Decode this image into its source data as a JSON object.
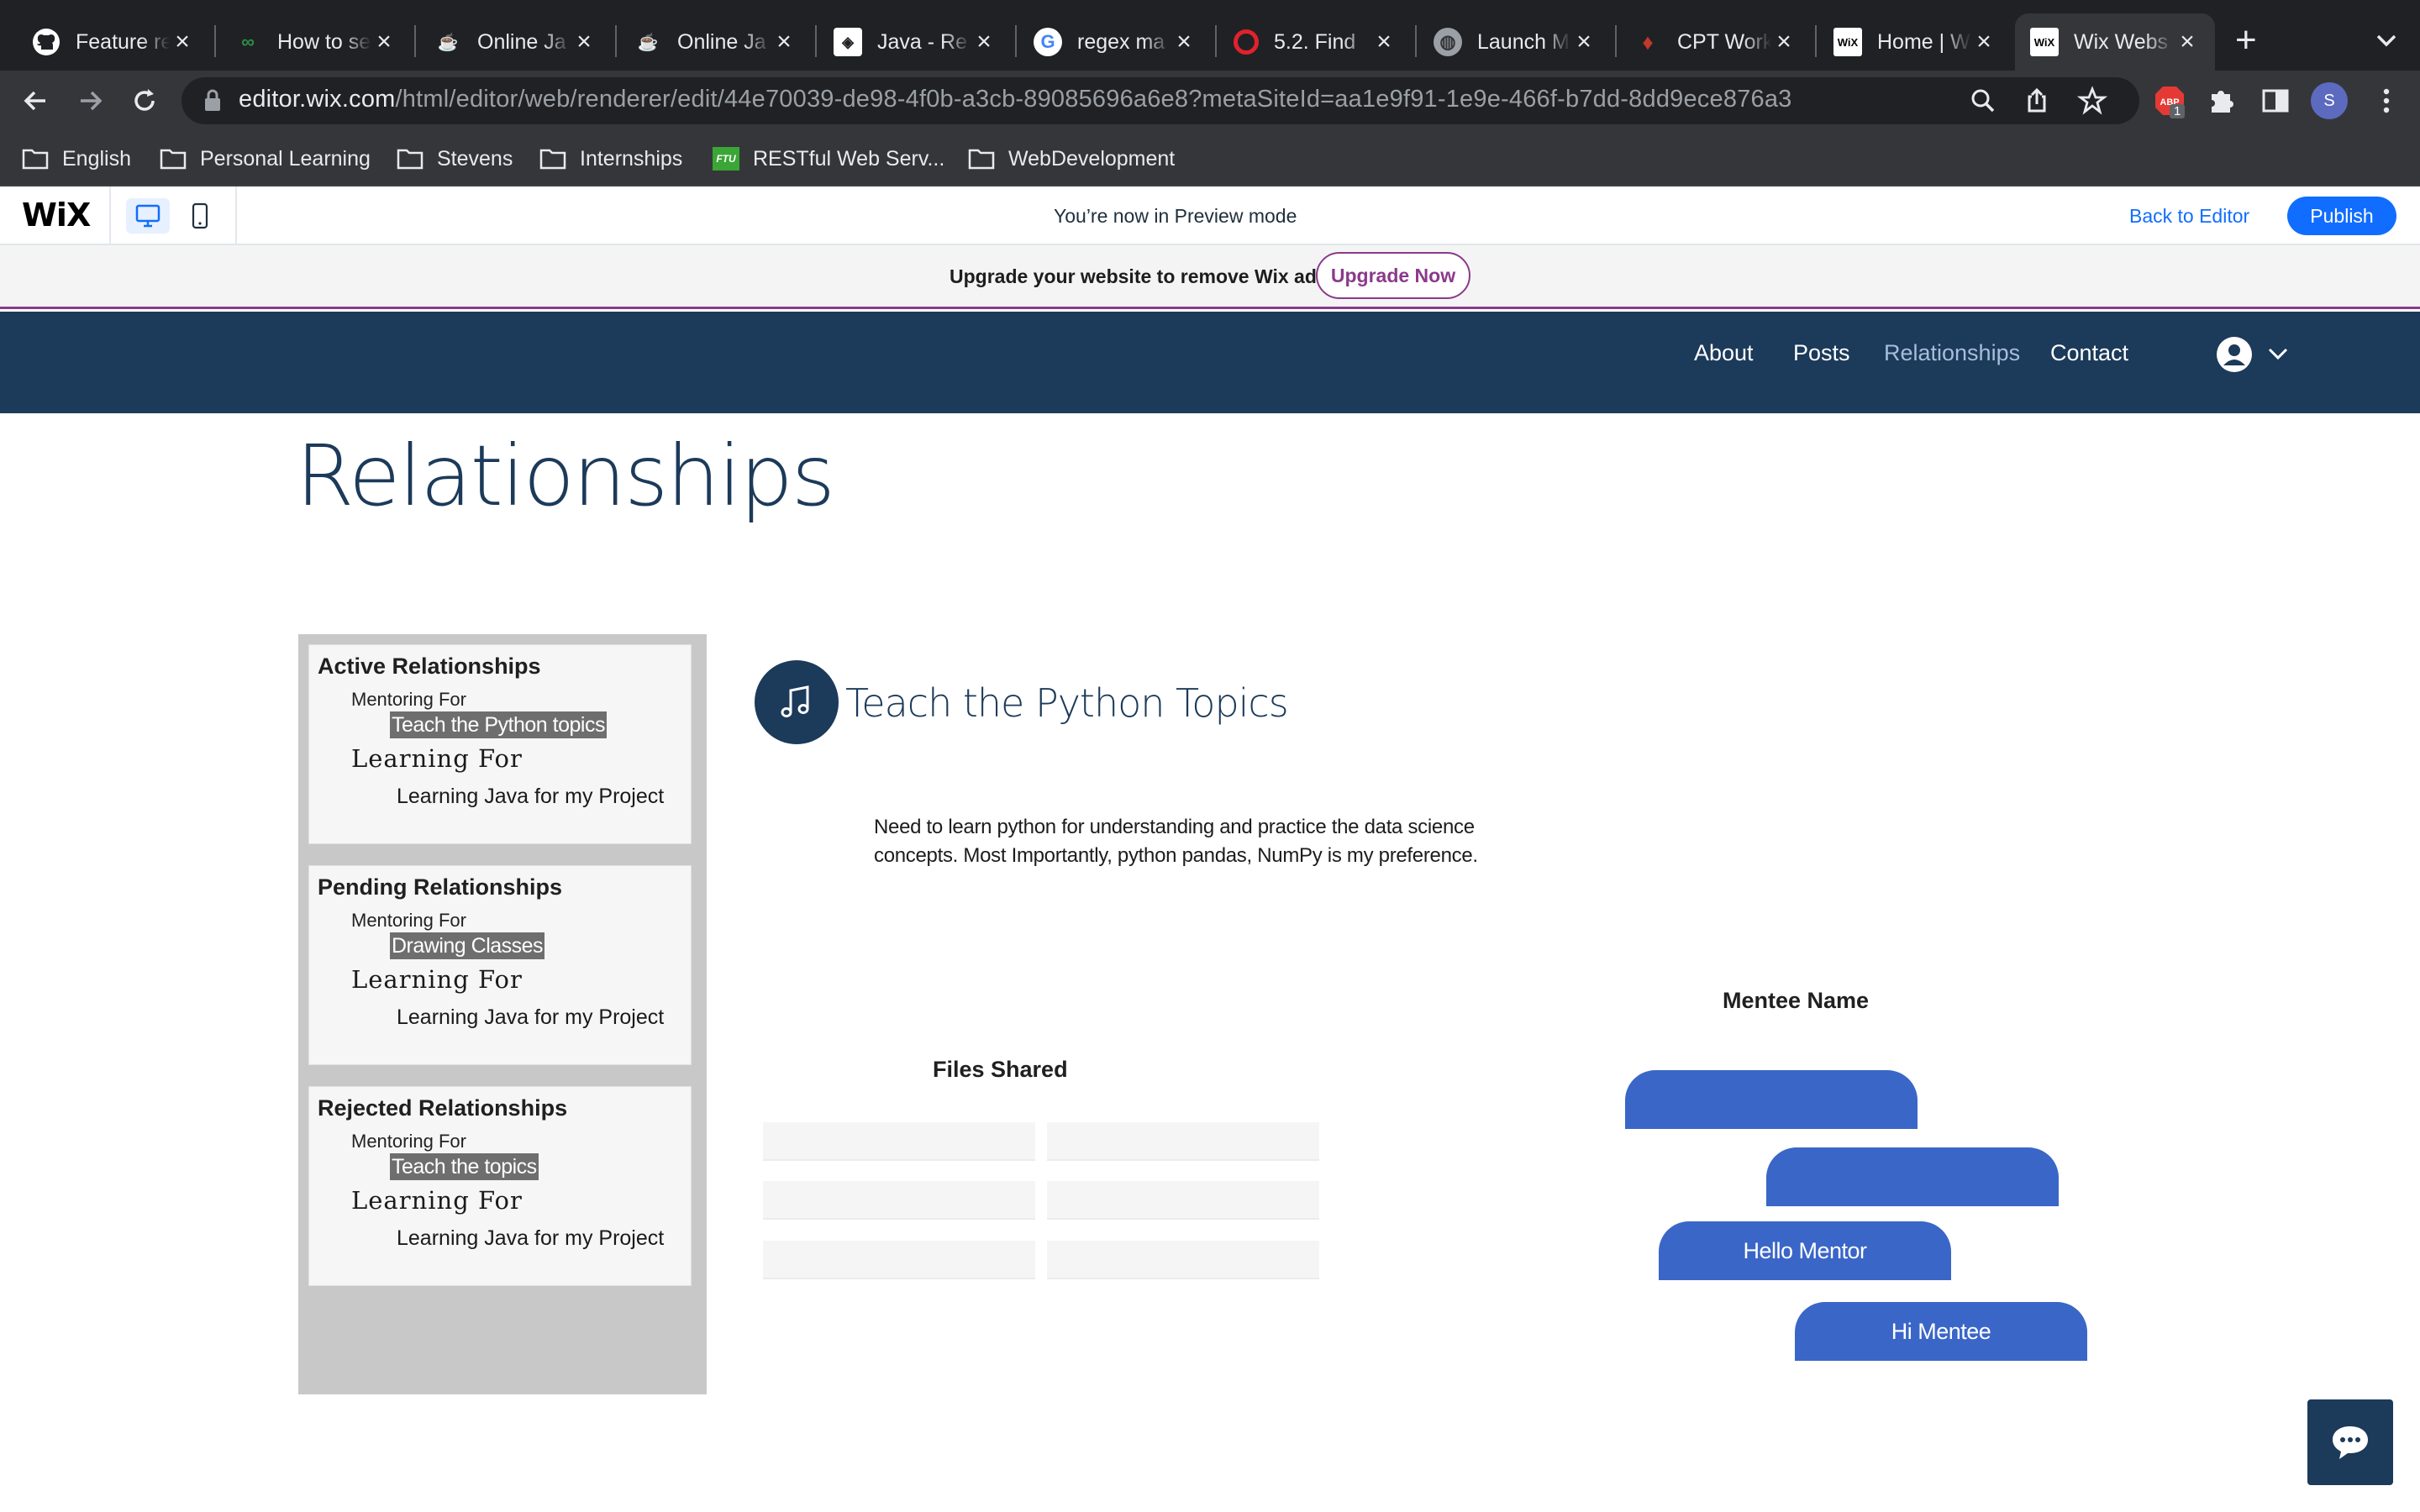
{
  "browser": {
    "tabs": [
      {
        "title": "Feature re",
        "favicon": "github-icon"
      },
      {
        "title": "How to se",
        "favicon": "geeksforgeeks-icon"
      },
      {
        "title": "Online Ja",
        "favicon": "online-java-icon"
      },
      {
        "title": "Online Ja",
        "favicon": "online-java-icon"
      },
      {
        "title": "Java - Re",
        "favicon": "java-ref-icon"
      },
      {
        "title": "regex ma",
        "favicon": "google-icon"
      },
      {
        "title": "5.2. Find",
        "favicon": "opera-icon"
      },
      {
        "title": "Launch M",
        "favicon": "globe-icon"
      },
      {
        "title": "CPT Work",
        "favicon": "cpt-icon"
      },
      {
        "title": "Home | W",
        "favicon": "wix-icon"
      },
      {
        "title": "Wix Webs",
        "favicon": "wix-icon"
      }
    ],
    "url_host": "editor.wix.com",
    "url_path": "/html/editor/web/renderer/edit/44e70039-de98-4f0b-a3cb-89085696a6e8?metaSiteId=aa1e9f91-1e9e-466f-b7dd-8dd9ece876a3",
    "extension_badge": "1",
    "profile_initial": "S",
    "bookmarks": [
      {
        "label": "English",
        "icon": "folder-icon"
      },
      {
        "label": "Personal Learning",
        "icon": "folder-icon"
      },
      {
        "label": "Stevens",
        "icon": "folder-icon"
      },
      {
        "label": "Internships",
        "icon": "folder-icon"
      },
      {
        "label": "RESTful Web Serv...",
        "icon": "ftu-icon"
      },
      {
        "label": "WebDevelopment",
        "icon": "folder-icon"
      }
    ]
  },
  "wix_bar": {
    "logo": "WiX",
    "preview_message": "You’re now in Preview mode",
    "back_to_editor": "Back to Editor",
    "publish": "Publish"
  },
  "ads": {
    "message": "Upgrade your website to remove Wix ads",
    "upgrade_button": "Upgrade Now"
  },
  "site_nav": {
    "items": [
      "About",
      "Posts",
      "Relationships",
      "Contact"
    ],
    "active": "Relationships"
  },
  "page": {
    "title": "Relationships",
    "relationships": [
      {
        "heading": "Active Relationships",
        "mentoring_label": "Mentoring For",
        "mentoring_topic": "Teach the Python topics",
        "learning_label": "Learning For",
        "learning_topic": "Learning Java for my Project"
      },
      {
        "heading": "Pending Relationships",
        "mentoring_label": "Mentoring For",
        "mentoring_topic": "Drawing Classes",
        "learning_label": "Learning For",
        "learning_topic": "Learning Java for my Project"
      },
      {
        "heading": "Rejected Relationships",
        "mentoring_label": "Mentoring For",
        "mentoring_topic": "Teach the topics",
        "learning_label": "Learning For",
        "learning_topic": "Learning Java for my Project"
      }
    ],
    "topic": {
      "title": "Teach the Python Topics",
      "icon": "music-note-icon",
      "description": "Need to learn python for understanding and practice the data science concepts. Most Importantly, python pandas, NumPy is my preference."
    },
    "files_shared_label": "Files Shared",
    "mentee_name_label": "Mentee Name",
    "chat_messages": [
      "",
      "",
      "Hello Mentor",
      "Hi Mentee"
    ]
  },
  "colors": {
    "site_header": "#1c3a5a",
    "chat_bubble": "#3a66c8",
    "wix_blue": "#116dff",
    "upgrade_purple": "#8b3a8b"
  }
}
